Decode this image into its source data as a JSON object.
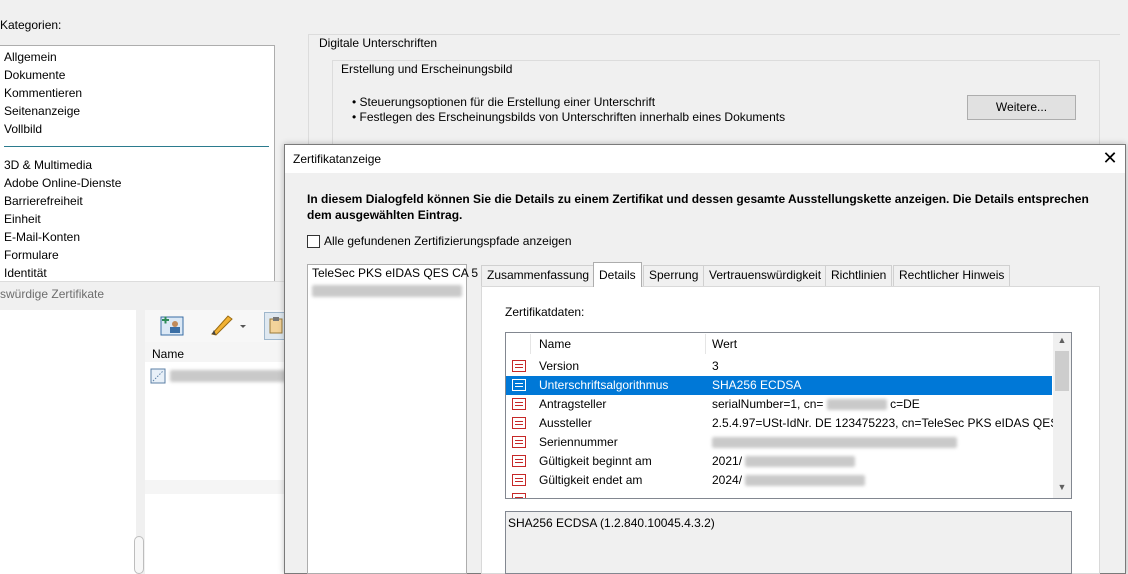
{
  "background_window": {
    "categories_label": "Kategorien:",
    "categories_group1": [
      "Allgemein",
      "Dokumente",
      "Kommentieren",
      "Seitenanzeige",
      "Vollbild"
    ],
    "categories_group2": [
      "3D & Multimedia",
      "Adobe Online-Dienste",
      "Barrierefreiheit",
      "Einheit",
      "E-Mail-Konten",
      "Formulare",
      "Identität"
    ],
    "section_title": "Digitale Unterschriften",
    "subsection_title": "Erstellung und Erscheinungsbild",
    "bullets": [
      "• Steuerungsoptionen für die Erstellung einer Unterschrift",
      "• Festlegen des Erscheinungsbilds von Unterschriften innerhalb eines Dokuments"
    ],
    "more_button": "Weitere..."
  },
  "trusted_certs_window": {
    "title": "swürdige Zertifikate",
    "column_name": "Name",
    "icons": [
      "add-contact-icon",
      "edit-pencil-icon",
      "import-icon"
    ]
  },
  "dialog": {
    "title": "Zertifikatanzeige",
    "close_glyph": "✕",
    "description": "In diesem Dialogfeld können Sie die Details zu einem Zertifikat und dessen gesamte Ausstellungskette anzeigen. Die Details entsprechen dem ausgewählten Eintrag.",
    "show_all_paths_label": "Alle gefundenen Zertifizierungspfade anzeigen",
    "show_all_paths_checked": false,
    "chain": [
      "TeleSec PKS eIDAS QES CA 5"
    ],
    "tabs": [
      {
        "label": "Zusammenfassung",
        "active": false
      },
      {
        "label": "Details",
        "active": true
      },
      {
        "label": "Sperrung",
        "active": false
      },
      {
        "label": "Vertrauenswürdigkeit",
        "active": false
      },
      {
        "label": "Richtlinien",
        "active": false
      },
      {
        "label": "Rechtlicher Hinweis",
        "active": false
      }
    ],
    "cert_data_label": "Zertifikatdaten:",
    "columns": {
      "name": "Name",
      "value": "Wert"
    },
    "rows": [
      {
        "name": "Version",
        "value": "3",
        "selected": false
      },
      {
        "name": "Unterschriftsalgorithmus",
        "value": "SHA256 ECDSA",
        "selected": true
      },
      {
        "name": "Antragsteller",
        "value": "serialNumber=1, cn=",
        "value_suffix": "c=DE",
        "selected": false
      },
      {
        "name": "Aussteller",
        "value": "2.5.4.97=USt-IdNr. DE 123475223, cn=TeleSec PKS eIDAS QES ...",
        "selected": false
      },
      {
        "name": "Seriennummer",
        "value": "",
        "selected": false
      },
      {
        "name": "Gültigkeit beginnt am",
        "value": "2021/",
        "selected": false
      },
      {
        "name": "Gültigkeit endet am",
        "value": "2024/",
        "selected": false
      }
    ],
    "detail_text": "SHA256 ECDSA (1.2.840.10045.4.3.2)",
    "accent_color": "#0078d7"
  }
}
